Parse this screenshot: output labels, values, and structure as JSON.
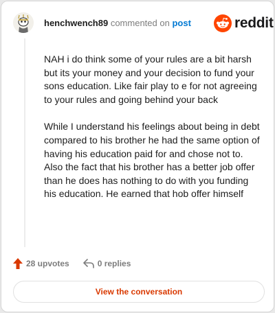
{
  "header": {
    "username": "henchwench89",
    "commented_on": "commented on",
    "post_link": "post"
  },
  "brand": {
    "wordmark": "reddit",
    "color": "#ff4500"
  },
  "comment": {
    "paragraphs": [
      "NAH i do think some of your rules are a bit harsh but its your money and your decision to fund your sons education. Like fair play to e for not agreeing to your rules and going behind your back",
      "While I understand his feelings about being in debt compared to his brother he had the same option of having his education paid for and chose not to. Also the fact that his brother has a better job offer than he does has nothing to do with you funding his education. He earned that hob offer himself"
    ]
  },
  "actions": {
    "upvotes": "28 upvotes",
    "replies": "0 replies",
    "upvote_color": "#d93900"
  },
  "cta": {
    "label": "View the conversation"
  },
  "icons": {
    "avatar": "snoo-avatar-icon",
    "logo": "reddit-logo-icon",
    "upvote": "upvote-arrow-icon",
    "reply": "reply-arrow-icon"
  }
}
